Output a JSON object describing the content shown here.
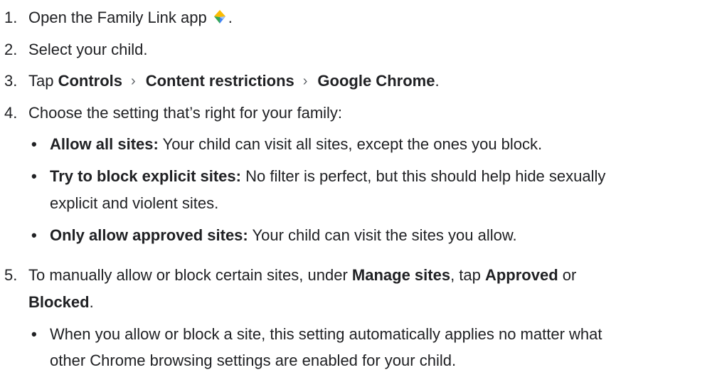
{
  "steps": {
    "s1": {
      "num": "1.",
      "text": "Open the Family Link app",
      "after_icon": "."
    },
    "s2": {
      "num": "2.",
      "text": "Select your child."
    },
    "s3": {
      "num": "3.",
      "prefix": "Tap ",
      "path1": "Controls",
      "path2": "Content restrictions",
      "path3": "Google Chrome",
      "suffix": ".",
      "separator": "›"
    },
    "s4": {
      "num": "4.",
      "text": "Choose the setting that’s right for your family:"
    },
    "s4_options": [
      {
        "bullet": "•",
        "title": "Allow all sites:",
        "desc": "Your child can visit all sites, except the ones you block."
      },
      {
        "bullet": "•",
        "title": "Try to block explicit sites:",
        "desc": "No filter is perfect, but this should help hide sexually",
        "desc2": "explicit and violent sites."
      },
      {
        "bullet": "•",
        "title": "Only allow approved sites:",
        "desc": "Your child can visit the sites you allow."
      }
    ],
    "s5": {
      "num": "5.",
      "t1": "To manually allow or block certain sites, under ",
      "b1": "Manage sites",
      "t2": ", tap ",
      "b2": "Approved",
      "t3": " or",
      "b3": "Blocked",
      "t4": "."
    },
    "s5_note": {
      "bullet": "•",
      "line1": "When you allow or block a site, this setting automatically applies no matter what",
      "line2": "other Chrome browsing settings are enabled for your child."
    }
  },
  "icons": {
    "family_link": "family-link-app-icon"
  },
  "colors": {
    "text": "#202124",
    "separator": "#5f6368",
    "icon_yellow": "#fbbc04",
    "icon_green": "#34a853",
    "icon_blue": "#4285f4",
    "icon_lightblue": "#a8c7fa"
  }
}
